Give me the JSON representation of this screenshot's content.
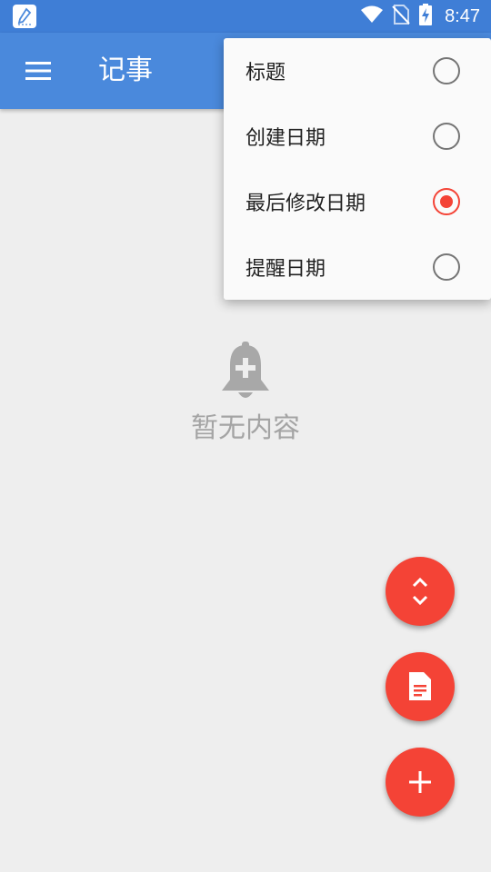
{
  "status_bar": {
    "time": "8:47",
    "icons": [
      "app-notification-icon",
      "wifi-icon",
      "no-sim-icon",
      "battery-charging-icon"
    ]
  },
  "toolbar": {
    "title": "记事",
    "menu_icon": "hamburger-menu-icon"
  },
  "sort_menu": {
    "items": [
      {
        "label": "标题",
        "selected": false
      },
      {
        "label": "创建日期",
        "selected": false
      },
      {
        "label": "最后修改日期",
        "selected": true
      },
      {
        "label": "提醒日期",
        "selected": false
      }
    ]
  },
  "empty_state": {
    "icon": "bell-plus-icon",
    "text": "暂无内容"
  },
  "fabs": [
    {
      "icon": "expand-collapse-icon"
    },
    {
      "icon": "note-icon"
    },
    {
      "icon": "add-icon"
    }
  ],
  "colors": {
    "status_bar": "#3f7ed6",
    "toolbar": "#4a89dc",
    "accent": "#f44336",
    "background": "#eeeeee",
    "menu_background": "#fafafa"
  }
}
